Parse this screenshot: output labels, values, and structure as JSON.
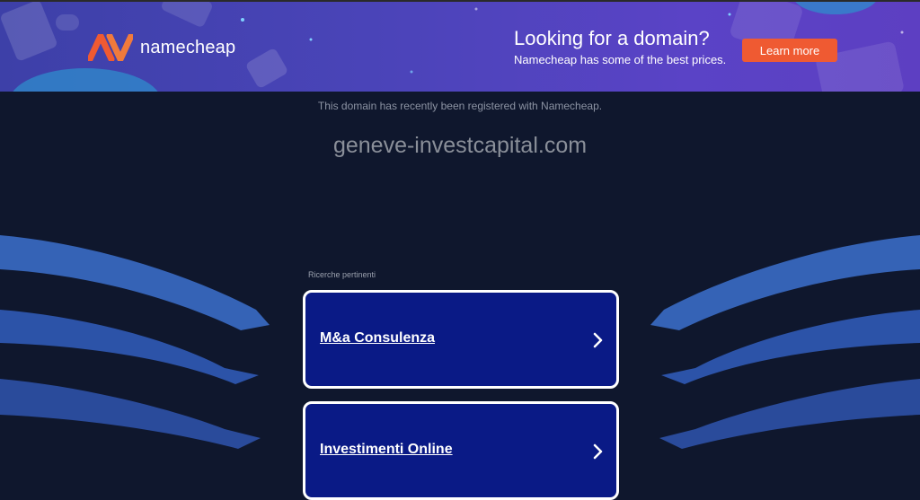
{
  "banner": {
    "brand": "namecheap",
    "promo_title": "Looking for a domain?",
    "promo_subtitle": "Namecheap has some of the best prices.",
    "cta_label": "Learn more",
    "colors": {
      "brand_orange": "#ef5a32",
      "banner_bg": "#4a44b8"
    }
  },
  "main": {
    "registered_note": "This domain has recently been registered with Namecheap.",
    "domain": "geneve-investcapital.com",
    "related_label": "Ricerche pertinenti",
    "results": [
      {
        "label": "M&a Consulenza",
        "icon": "chevron-right-icon"
      },
      {
        "label": "Investimenti Online",
        "icon": "chevron-right-icon"
      }
    ]
  },
  "colors": {
    "page_bg": "#0f172d",
    "card_bg": "#0a1a86",
    "wave": "#2d5fb5"
  }
}
